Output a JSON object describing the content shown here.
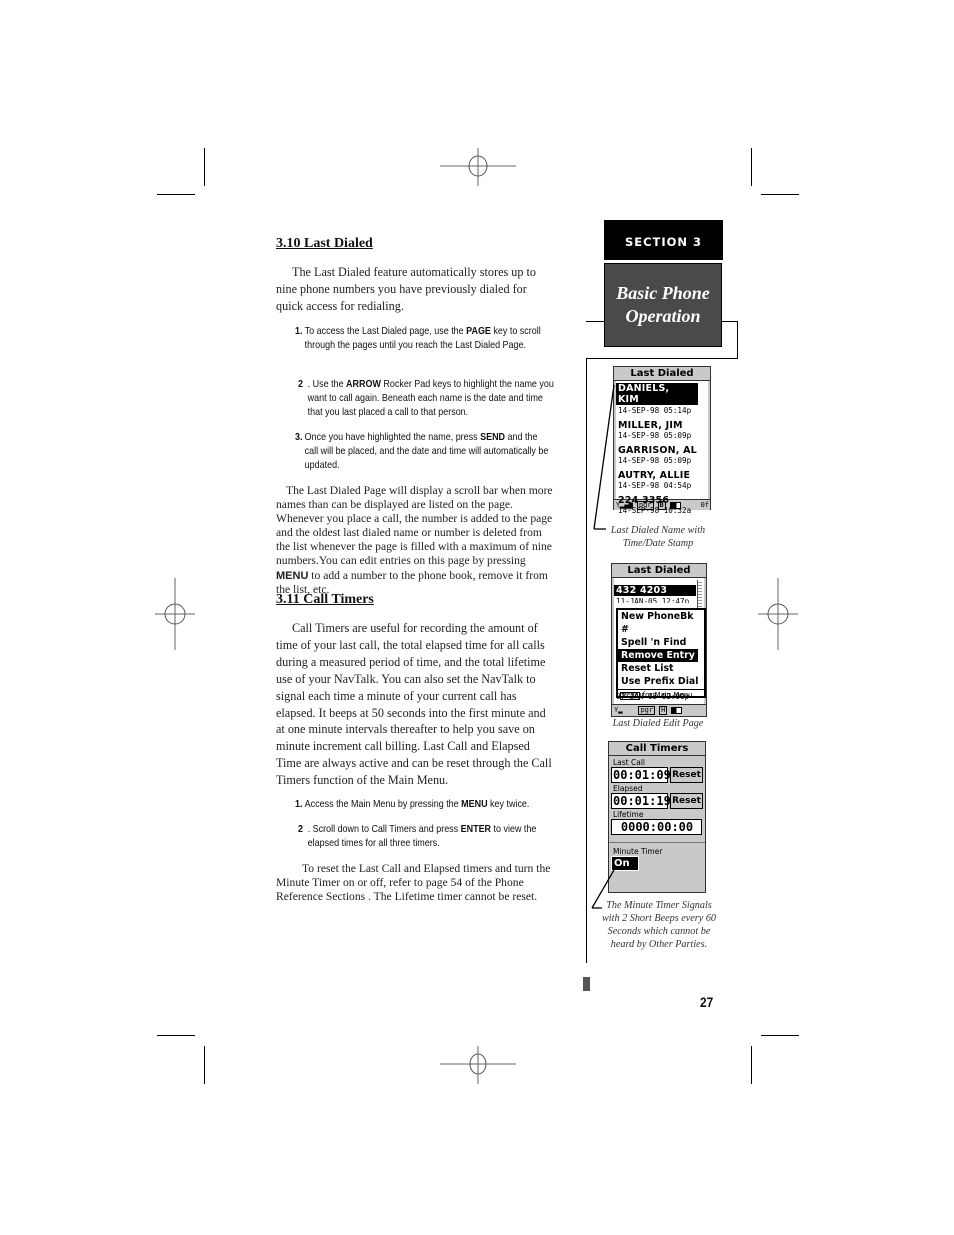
{
  "section_tab": {
    "label": "SECTION 3"
  },
  "section_title": {
    "line1": "Basic Phone",
    "line2": "Operation"
  },
  "sections": [
    {
      "heading": "3.10 Last Dialed",
      "intro": "The Last Dialed feature automatically stores up to nine phone numbers you have previously dialed for quick access for redialing.",
      "steps": [
        {
          "num": "1.",
          "pre": "To access the Last Dialed page, use the ",
          "key": "PAGE",
          "post": " key to scroll through the pages until you reach the Last Dialed Page."
        },
        {
          "num": "2",
          "pre": ". Use the ",
          "key": "ARROW",
          "post": " Rocker Pad keys to highlight the name you want to call again. Beneath each name is the date and time that you last placed a call to that person."
        },
        {
          "num": "3.",
          "pre": "Once you have highlighted the name, press ",
          "key": "SEND",
          "post": " and the call will be placed, and the date and time will automatically be updated."
        }
      ],
      "closing_pre": "The Last Dialed Page will display a scroll bar when more names than can be displayed are listed on the page. Whenever you place a call, the number is added to the page and the oldest last dialed name or number is deleted from the list whenever the page is filled with a maximum of nine numbers.You can edit entries on this page by pressing ",
      "closing_key": "MENU",
      "closing_post": " to add a number to the phone book, remove it from the list, etc."
    },
    {
      "heading": "3.11 Call Timers",
      "intro": "Call Timers are useful for recording the amount of time of your last call, the total elapsed time for all calls during a measured period of time, and the total lifetime use of your NavTalk. You can also set the NavTalk to signal each time a minute of your current call has elapsed. It beeps at 50 seconds into the first minute and at one minute intervals thereafter to help you save on minute increment call billing. Last Call and Elapsed Time are always active and can be reset through the Call Timers function of the Main Menu.",
      "steps": [
        {
          "num": "1.",
          "pre": " Access the Main Menu by pressing the ",
          "key": "MENU",
          "post": " key twice."
        },
        {
          "num": "2",
          "pre": ". Scroll down to Call Timers and press ",
          "key": "ENTER",
          "post": " to view the elapsed times for all three timers."
        }
      ],
      "closing": "To reset the Last Call and Elapsed timers and turn the Minute Timer on or off, refer to page 54 of the Phone Reference Sections . The Lifetime timer cannot be reset."
    }
  ],
  "screen_last_dialed": {
    "title": "Last Dialed",
    "entries": [
      {
        "name": "DANIELS, KIM",
        "stamp": "14-SEP-98  05:14p",
        "highlighted": true
      },
      {
        "name": "MILLER, JIM",
        "stamp": "14-SEP-98  05:09p",
        "highlighted": false
      },
      {
        "name": "GARRISON, AL",
        "stamp": "14-SEP-98  05:09p",
        "highlighted": false
      },
      {
        "name": "AUTRY, ALLIE",
        "stamp": "14-SEP-98  04:54p",
        "highlighted": false
      },
      {
        "name": "224 3356",
        "stamp": "14-SEP-98  10:32a",
        "highlighted": false
      }
    ],
    "status": {
      "pgr": "pgr",
      "b": "B",
      "right": "0f"
    },
    "caption": "Last Dialed Name with Time/Date Stamp"
  },
  "screen_edit": {
    "title": "Last Dialed",
    "top_entry": "432 4203",
    "top_stamp": "11-JAN-05 12:47p",
    "menu": [
      {
        "label": "New PhoneBk #",
        "highlighted": false
      },
      {
        "label": "Spell 'n Find",
        "highlighted": false
      },
      {
        "label": "Remove Entry",
        "highlighted": true
      },
      {
        "label": "Reset List",
        "highlighted": false
      },
      {
        "label": "Use Prefix Dial",
        "highlighted": false
      }
    ],
    "menu_key": "MENU",
    "menu_hint": "for Main Menu",
    "bottom_stamp": "07-JAN-05 02:00p",
    "status": {
      "pgr": "pgr",
      "h": "H"
    },
    "caption": "Last Dialed Edit Page"
  },
  "screen_timers": {
    "title": "Call Timers",
    "last_call_label": "Last Call",
    "last_call_value": "00:01:09",
    "elapsed_label": "Elapsed",
    "elapsed_value": "00:01:19",
    "lifetime_label": "Lifetime",
    "lifetime_value": "0000:00:00",
    "reset_label": "Reset",
    "minute_timer_label": "Minute Timer",
    "minute_timer_value": "On",
    "caption": "The Minute Timer Signals with 2 Short Beeps every 60 Seconds which cannot be heard by Other Parties."
  },
  "page_number": "27"
}
